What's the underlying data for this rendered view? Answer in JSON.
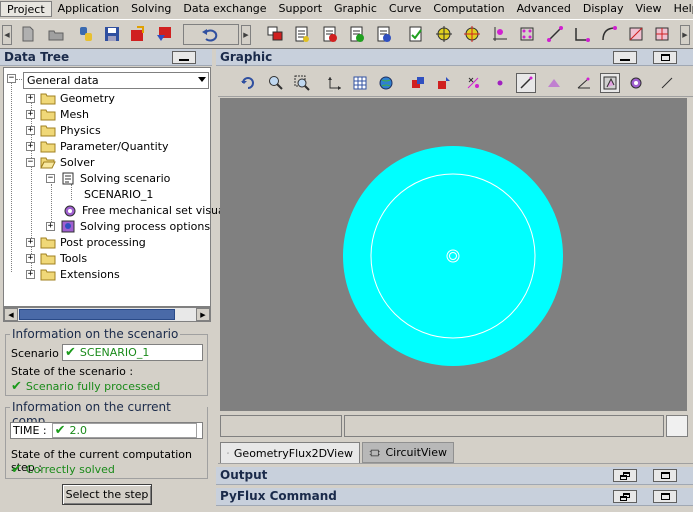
{
  "menubar": {
    "items": [
      "Project",
      "Application",
      "Solving",
      "Data exchange",
      "Support",
      "Graphic",
      "Curve",
      "Computation",
      "Advanced",
      "Display",
      "View",
      "Help"
    ]
  },
  "data_tree": {
    "title": "Data Tree",
    "root_combo": "General data",
    "items": [
      {
        "label": "Geometry",
        "expander": "+"
      },
      {
        "label": "Mesh",
        "expander": "+"
      },
      {
        "label": "Physics",
        "expander": "+"
      },
      {
        "label": "Parameter/Quantity",
        "expander": "+"
      },
      {
        "label": "Solver",
        "expander": "−"
      },
      {
        "label": "Solving scenario",
        "expander": "−"
      },
      {
        "label": "SCENARIO_1"
      },
      {
        "label": "Free mechanical set visuali"
      },
      {
        "label": "Solving process options",
        "expander": "+"
      },
      {
        "label": "Post processing",
        "expander": "+"
      },
      {
        "label": "Tools",
        "expander": "+"
      },
      {
        "label": "Extensions",
        "expander": "+"
      }
    ]
  },
  "info": {
    "scenario_group_title": "Information on the scenario",
    "scenario_label": "Scenario :",
    "scenario_value": "SCENARIO_1",
    "scenario_state_label": "State of the scenario :",
    "scenario_state_value": "Scenario fully processed",
    "step_group_title": "Information on the current comp...",
    "time_label": "TIME :",
    "time_value": "2.0",
    "step_state_label": "State of the current computation step :",
    "step_state_value": "Correctly solved",
    "select_step_button": "Select the step"
  },
  "graphic": {
    "title": "Graphic",
    "tabs": [
      {
        "label": "GeometryFlux2DView",
        "active": true
      },
      {
        "label": "CircuitView",
        "active": false
      }
    ],
    "colors": {
      "background": "#808080",
      "domain": "#00ffff",
      "lines": "#ffffff"
    }
  },
  "output": {
    "title": "Output"
  },
  "pyflux": {
    "title": "PyFlux Command"
  }
}
